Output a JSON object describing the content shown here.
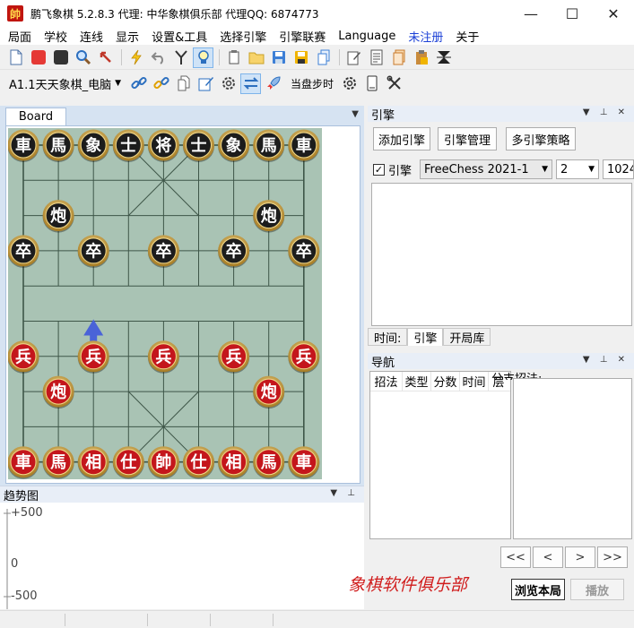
{
  "window": {
    "app_icon_glyph": "帥",
    "title": "鹏飞象棋 5.2.8.3   代理: 中华象棋俱乐部   代理QQ: 6874773",
    "minimize": "—",
    "maximize": "☐",
    "close": "✕"
  },
  "menu": {
    "items": [
      "局面",
      "学校",
      "连线",
      "显示",
      "设置&工具",
      "选择引擎",
      "引擎联赛",
      "Language",
      "未注册",
      "关于"
    ]
  },
  "toolbar2": {
    "preset": "A1.1天天象棋_电脑",
    "step_label": "当盘步时"
  },
  "board_panel": {
    "tab_label": "Board",
    "black_pieces": [
      {
        "char": "車",
        "col": 0,
        "row": 0
      },
      {
        "char": "馬",
        "col": 1,
        "row": 0
      },
      {
        "char": "象",
        "col": 2,
        "row": 0
      },
      {
        "char": "士",
        "col": 3,
        "row": 0
      },
      {
        "char": "将",
        "col": 4,
        "row": 0
      },
      {
        "char": "士",
        "col": 5,
        "row": 0
      },
      {
        "char": "象",
        "col": 6,
        "row": 0
      },
      {
        "char": "馬",
        "col": 7,
        "row": 0
      },
      {
        "char": "車",
        "col": 8,
        "row": 0
      },
      {
        "char": "炮",
        "col": 1,
        "row": 2
      },
      {
        "char": "炮",
        "col": 7,
        "row": 2
      },
      {
        "char": "卒",
        "col": 0,
        "row": 3
      },
      {
        "char": "卒",
        "col": 2,
        "row": 3
      },
      {
        "char": "卒",
        "col": 4,
        "row": 3
      },
      {
        "char": "卒",
        "col": 6,
        "row": 3
      },
      {
        "char": "卒",
        "col": 8,
        "row": 3
      }
    ],
    "red_pieces": [
      {
        "char": "兵",
        "col": 0,
        "row": 6
      },
      {
        "char": "兵",
        "col": 2,
        "row": 6
      },
      {
        "char": "兵",
        "col": 4,
        "row": 6
      },
      {
        "char": "兵",
        "col": 6,
        "row": 6
      },
      {
        "char": "兵",
        "col": 8,
        "row": 6
      },
      {
        "char": "炮",
        "col": 1,
        "row": 7
      },
      {
        "char": "炮",
        "col": 7,
        "row": 7
      },
      {
        "char": "車",
        "col": 0,
        "row": 9
      },
      {
        "char": "馬",
        "col": 1,
        "row": 9
      },
      {
        "char": "相",
        "col": 2,
        "row": 9
      },
      {
        "char": "仕",
        "col": 3,
        "row": 9
      },
      {
        "char": "帥",
        "col": 4,
        "row": 9
      },
      {
        "char": "仕",
        "col": 5,
        "row": 9
      },
      {
        "char": "相",
        "col": 6,
        "row": 9
      },
      {
        "char": "馬",
        "col": 7,
        "row": 9
      },
      {
        "char": "車",
        "col": 8,
        "row": 9
      }
    ],
    "hint_arrow": {
      "col": 2,
      "from_row": 6,
      "to_row": 5,
      "color": "#4a63d8"
    },
    "colors": {
      "board_bg": "#a9c3b4",
      "line": "#3e5648",
      "black_piece": "#1c1c1c",
      "red_piece": "#c4161c",
      "piece_rim": "#c9a24a"
    }
  },
  "trend_panel": {
    "title": "趋势图",
    "label_top": "+500",
    "label_mid": "0",
    "label_bottom": "-500"
  },
  "engine_panel": {
    "title": "引擎",
    "add_button": "添加引擎",
    "manage_button": "引擎管理",
    "strategy_button": "多引擎策略",
    "enable_label": "引擎",
    "checkbox_mark": "✓",
    "engine_name": "FreeChess  2021-1",
    "threads": "2",
    "hash": "1024",
    "tabs": [
      "时间:",
      "引擎",
      "开局库"
    ]
  },
  "nav_panel": {
    "title": "导航",
    "columns": [
      "招法",
      "类型",
      "分数",
      "时间",
      "层"
    ],
    "branch_label": "分支招法:",
    "first_button": "<<",
    "prev_button": "<",
    "next_button": ">",
    "last_button": ">>",
    "club_text": "象棋软件俱乐部",
    "browse_button": "浏览本局",
    "play_button": "播放"
  }
}
